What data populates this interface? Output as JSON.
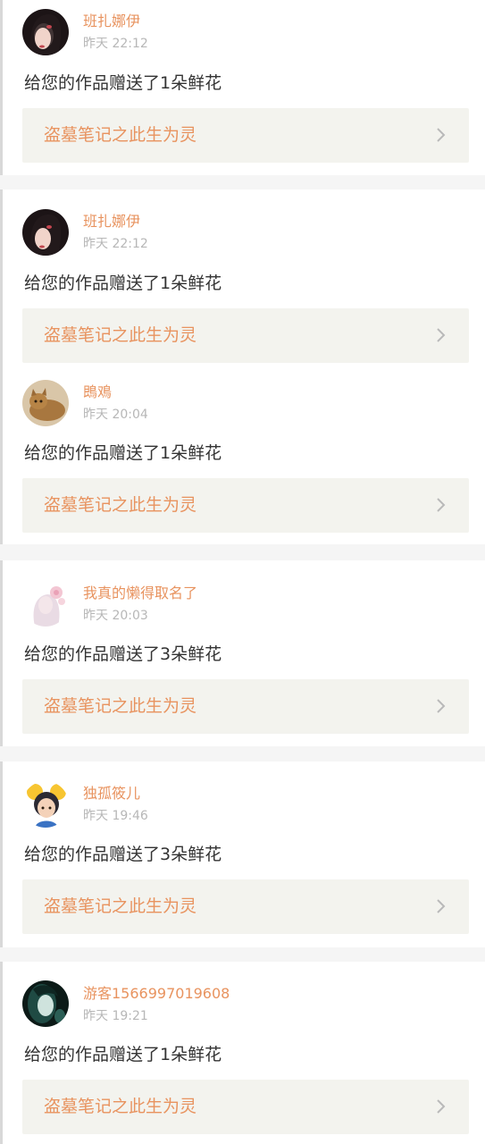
{
  "notifications": [
    {
      "username": "班扎娜伊",
      "time": "昨天 22:12",
      "message": "给您的作品赠送了1朵鲜花",
      "work_title": "盗墓笔记之此生为灵",
      "avatar_icon": "avatar-girl-dark-hair-icon"
    },
    {
      "username": "班扎娜伊",
      "time": "昨天 22:12",
      "message": "给您的作品赠送了1朵鲜花",
      "work_title": "盗墓笔记之此生为灵",
      "avatar_icon": "avatar-girl-dark-hair-icon"
    },
    {
      "username": "鵖鳮",
      "time": "昨天 20:04",
      "message": "给您的作品赠送了1朵鲜花",
      "work_title": "盗墓笔记之此生为灵",
      "avatar_icon": "avatar-cat-icon"
    },
    {
      "username": "我真的懒得取名了",
      "time": "昨天 20:03",
      "message": "给您的作品赠送了3朵鲜花",
      "work_title": "盗墓笔记之此生为灵",
      "avatar_icon": "avatar-flower-girl-icon"
    },
    {
      "username": "独孤筱儿",
      "time": "昨天 19:46",
      "message": "给您的作品赠送了3朵鲜花",
      "work_title": "盗墓笔记之此生为灵",
      "avatar_icon": "avatar-cartoon-girl-icon"
    },
    {
      "username": "游客1566997019608",
      "time": "昨天 19:21",
      "message": "给您的作品赠送了1朵鲜花",
      "work_title": "盗墓笔记之此生为灵",
      "avatar_icon": "avatar-teal-portrait-icon"
    }
  ],
  "colors": {
    "accent": "#e8935f",
    "timestamp": "#b7b7b7",
    "text": "#333333",
    "link_bg": "#f3f3ee",
    "page_bg": "#f5f5f5"
  }
}
